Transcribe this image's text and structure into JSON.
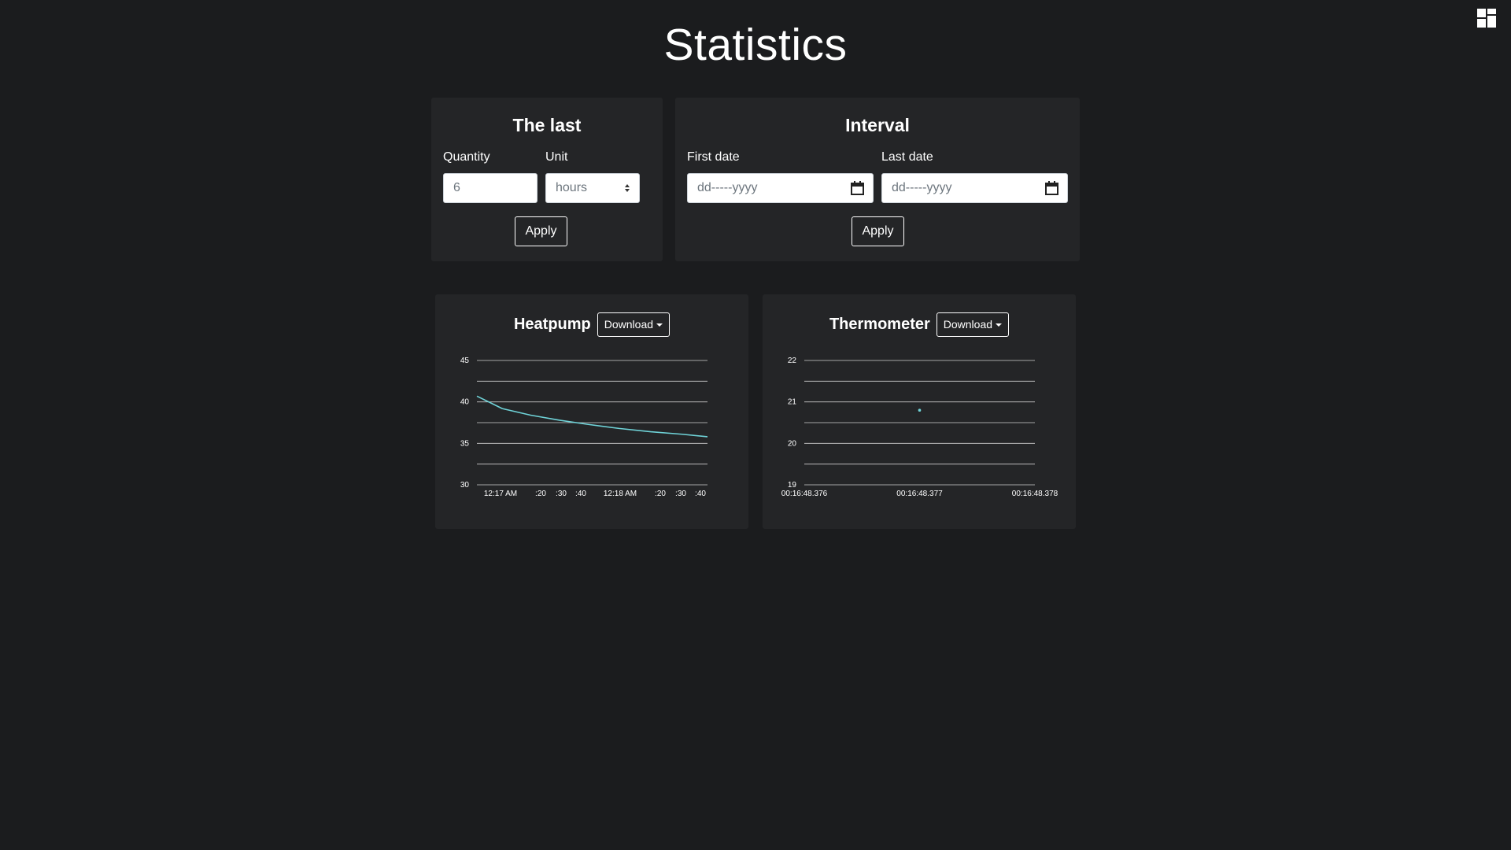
{
  "page": {
    "title": "Statistics"
  },
  "the_last": {
    "title": "The last",
    "quantity_label": "Quantity",
    "quantity_value": "6",
    "unit_label": "Unit",
    "unit_value": "hours",
    "apply_label": "Apply"
  },
  "interval": {
    "title": "Interval",
    "first_date_label": "First date",
    "first_date_placeholder": "dd-----yyyy",
    "last_date_label": "Last date",
    "last_date_placeholder": "dd-----yyyy",
    "apply_label": "Apply"
  },
  "charts": {
    "heatpump": {
      "title": "Heatpump",
      "download_label": "Download"
    },
    "thermometer": {
      "title": "Thermometer",
      "download_label": "Download"
    }
  },
  "colors": {
    "background": "#1b1c1e",
    "card": "#242527",
    "line": "#6fd3d8"
  },
  "icons": {
    "dashboard": "dashboard-grid-icon",
    "calendar": "calendar-icon",
    "select": "select-arrows-icon"
  },
  "chart_data": [
    {
      "type": "line",
      "title": "Heatpump",
      "ylim": [
        30,
        45
      ],
      "yticks": [
        30,
        35,
        40,
        45
      ],
      "xticks": [
        "12:17 AM",
        ":20",
        ":30",
        ":40",
        "12:18 AM",
        ":20",
        ":30",
        ":40"
      ],
      "grid": true,
      "series": [
        {
          "x_index": [
            0.0,
            0.8,
            1.7,
            2.6,
            3.5,
            4.5,
            5.5,
            6.5,
            7.3
          ],
          "values": [
            40.7,
            39.2,
            38.4,
            37.8,
            37.3,
            36.8,
            36.4,
            36.1,
            35.8
          ]
        }
      ]
    },
    {
      "type": "scatter",
      "title": "Thermometer",
      "ylim": [
        19,
        22
      ],
      "yticks": [
        19,
        20,
        21,
        22
      ],
      "xticks": [
        "00:16:48.376",
        "00:16:48.377",
        "00:16:48.378"
      ],
      "grid": true,
      "series": [
        {
          "x": [
            "00:16:48.377"
          ],
          "values": [
            20.8
          ]
        }
      ]
    }
  ]
}
